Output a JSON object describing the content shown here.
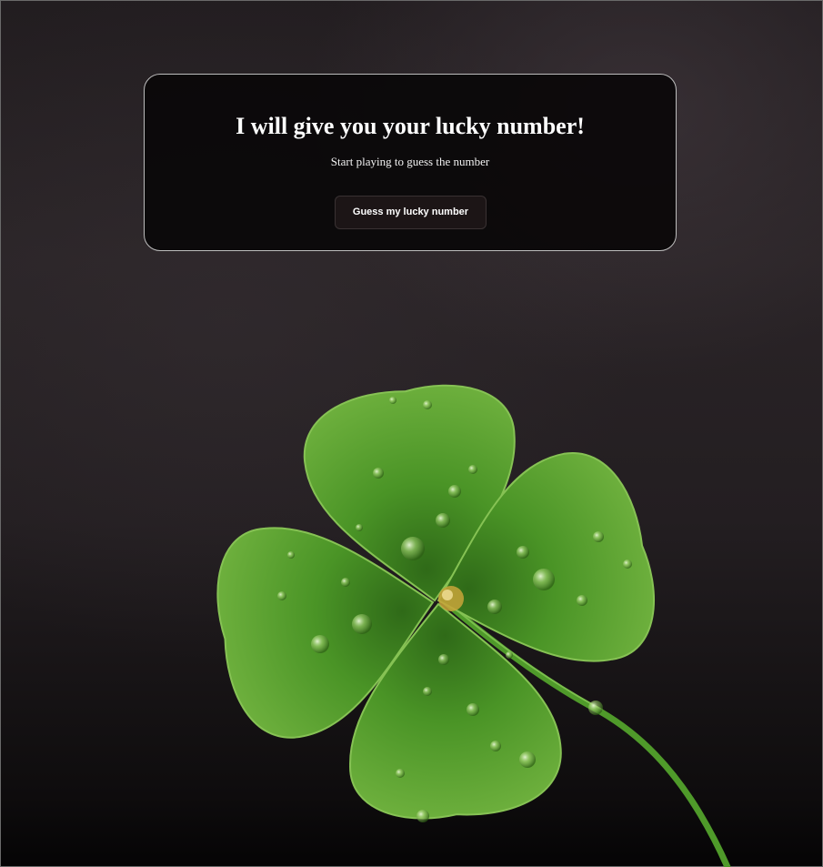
{
  "hero": {
    "title": "I will give you your lucky number!",
    "subtitle": "Start playing to guess the number",
    "button_label": "Guess my lucky number"
  },
  "background": {
    "image_subject": "four-leaf-clover-with-water-drops",
    "colors": {
      "backdrop": "#231e21",
      "leaf": "#4f9a2a",
      "leaf_dark": "#2f6a18",
      "stem": "#5aa83a",
      "card": "#0a0809",
      "card_border": "#bdbdbd",
      "button": "#1c1516"
    }
  }
}
